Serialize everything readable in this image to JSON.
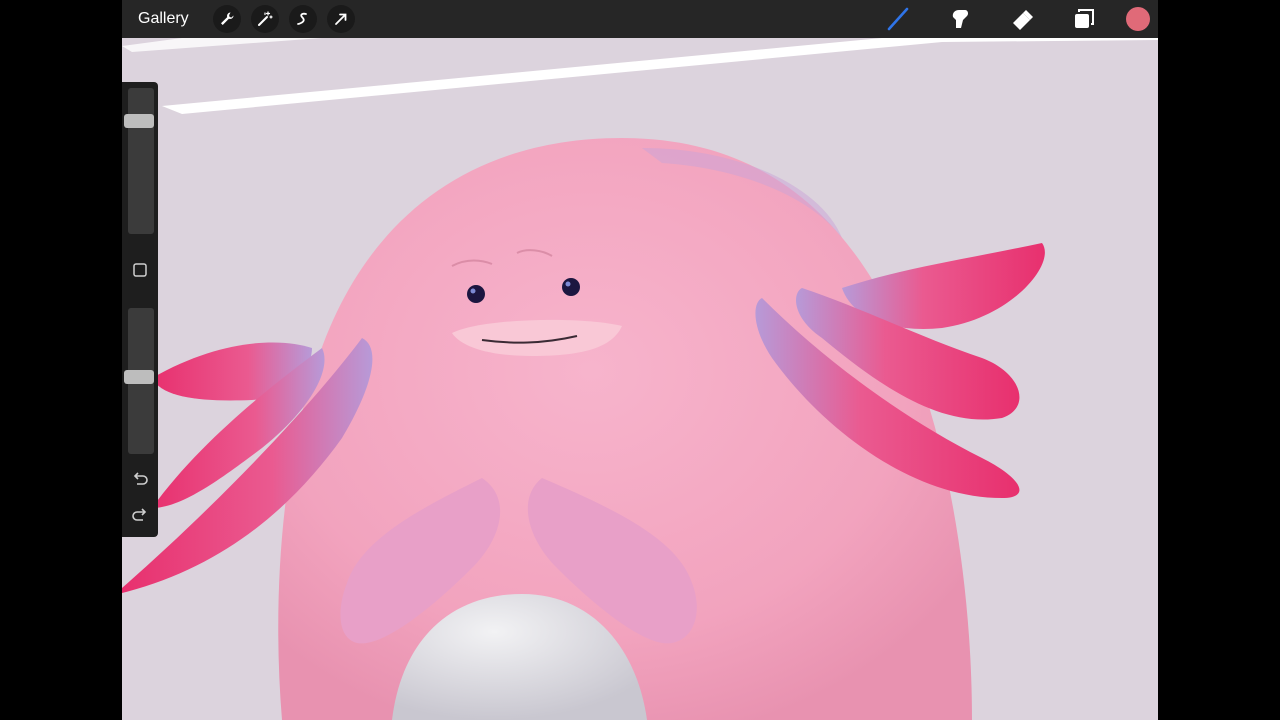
{
  "toolbar": {
    "gallery_label": "Gallery",
    "left_icons": [
      "wrench-icon",
      "magic-wand-icon",
      "selection-icon",
      "transform-arrow-icon"
    ],
    "right_icons": [
      "brush-icon",
      "smudge-icon",
      "eraser-icon",
      "layers-icon"
    ],
    "active_tool": "brush",
    "current_color": "#e06a78",
    "brush_accent": "#2f74e8"
  },
  "sidebar": {
    "brush_size": 0.8,
    "opacity": 0.53,
    "icons": [
      "modify-square-icon",
      "undo-icon",
      "redo-icon"
    ]
  }
}
